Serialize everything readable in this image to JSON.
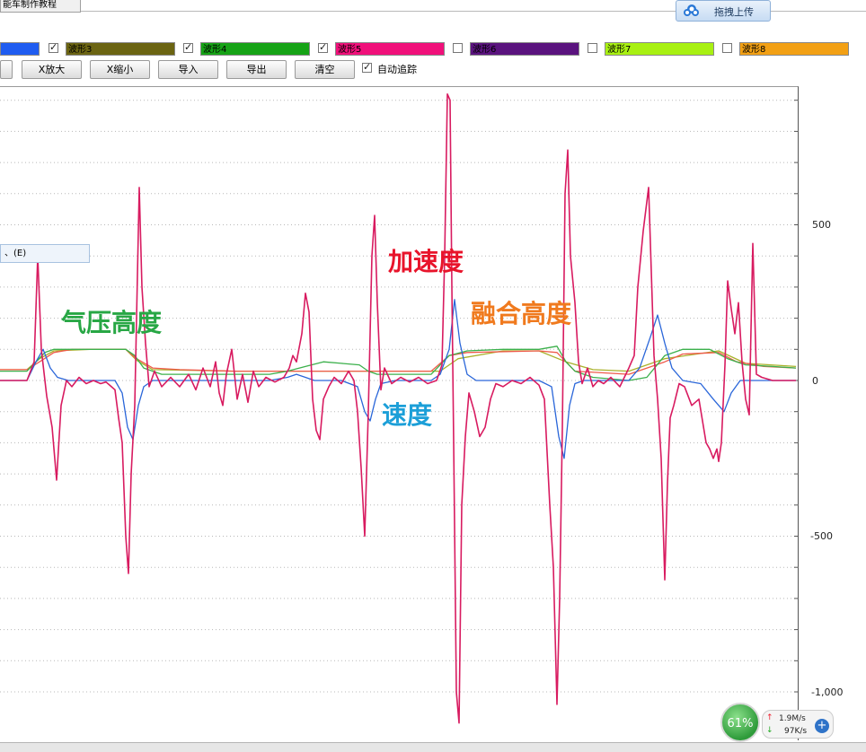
{
  "window": {
    "tab_title": "能车制作教程"
  },
  "upload_button": {
    "label": "拖拽上传",
    "icon": "cloud-icon"
  },
  "waveforms": [
    {
      "label": "",
      "checked": false,
      "color": "#1f5cf0"
    },
    {
      "label": "波形3",
      "checked": true,
      "color": "#6b6412"
    },
    {
      "label": "波形4",
      "checked": true,
      "color": "#16a316"
    },
    {
      "label": "波形5",
      "checked": true,
      "color": "#f0107a"
    },
    {
      "label": "波形6",
      "checked": false,
      "color": "#5a137e"
    },
    {
      "label": "波形7",
      "checked": false,
      "color": "#a8f012"
    },
    {
      "label": "波形8",
      "checked": false,
      "color": "#f2a014"
    }
  ],
  "toolbar": {
    "buttons": [
      "X放大",
      "X缩小",
      "导入",
      "导出",
      "清空"
    ],
    "auto_track_label": "自动追踪",
    "auto_track_checked": true
  },
  "tooltip": {
    "text": "、(E)"
  },
  "annotations": {
    "air_pressure": {
      "text": "气压高度",
      "color": "#28a745"
    },
    "acceleration": {
      "text": "加速度",
      "color": "#e8142b"
    },
    "fused_height": {
      "text": "融合高度",
      "color": "#f07a1e"
    },
    "velocity": {
      "text": "速度",
      "color": "#1c9fd8"
    }
  },
  "status": {
    "cpu_percent": "61%",
    "upload_speed": "1.9M/s",
    "download_speed": "97K/s"
  },
  "chart_data": {
    "type": "line",
    "y_ticks": [
      "500",
      "0",
      "-500",
      "-1,000"
    ],
    "ylim": [
      -1100,
      920
    ],
    "grid": "horizontal dotted",
    "series": [
      {
        "name": "加速度",
        "color": "#d81b60",
        "points": [
          [
            0,
            0
          ],
          [
            30,
            0
          ],
          [
            38,
            60
          ],
          [
            42,
            400
          ],
          [
            46,
            100
          ],
          [
            52,
            -50
          ],
          [
            58,
            -150
          ],
          [
            63,
            -320
          ],
          [
            68,
            -80
          ],
          [
            74,
            0
          ],
          [
            80,
            -20
          ],
          [
            88,
            10
          ],
          [
            96,
            -10
          ],
          [
            104,
            0
          ],
          [
            112,
            -10
          ],
          [
            118,
            -5
          ],
          [
            124,
            -20
          ],
          [
            128,
            -30
          ],
          [
            132,
            -120
          ],
          [
            136,
            -200
          ],
          [
            140,
            -500
          ],
          [
            143,
            -620
          ],
          [
            146,
            -300
          ],
          [
            150,
            -80
          ],
          [
            152,
            200
          ],
          [
            155,
            620
          ],
          [
            158,
            300
          ],
          [
            162,
            120
          ],
          [
            166,
            -20
          ],
          [
            172,
            30
          ],
          [
            180,
            -20
          ],
          [
            190,
            10
          ],
          [
            200,
            -20
          ],
          [
            210,
            20
          ],
          [
            218,
            -30
          ],
          [
            226,
            40
          ],
          [
            234,
            -20
          ],
          [
            240,
            60
          ],
          [
            244,
            -40
          ],
          [
            248,
            -80
          ],
          [
            252,
            20
          ],
          [
            258,
            100
          ],
          [
            264,
            -60
          ],
          [
            270,
            20
          ],
          [
            276,
            -70
          ],
          [
            282,
            30
          ],
          [
            288,
            -20
          ],
          [
            296,
            10
          ],
          [
            306,
            -5
          ],
          [
            316,
            10
          ],
          [
            322,
            40
          ],
          [
            326,
            80
          ],
          [
            330,
            60
          ],
          [
            336,
            150
          ],
          [
            340,
            280
          ],
          [
            344,
            220
          ],
          [
            348,
            -60
          ],
          [
            352,
            -160
          ],
          [
            356,
            -190
          ],
          [
            360,
            -60
          ],
          [
            366,
            -20
          ],
          [
            372,
            10
          ],
          [
            380,
            -10
          ],
          [
            388,
            30
          ],
          [
            394,
            0
          ],
          [
            398,
            -100
          ],
          [
            402,
            -280
          ],
          [
            406,
            -500
          ],
          [
            410,
            -100
          ],
          [
            414,
            400
          ],
          [
            417,
            530
          ],
          [
            420,
            250
          ],
          [
            424,
            -30
          ],
          [
            428,
            40
          ],
          [
            436,
            -10
          ],
          [
            446,
            10
          ],
          [
            456,
            -5
          ],
          [
            466,
            10
          ],
          [
            476,
            -10
          ],
          [
            486,
            0
          ],
          [
            492,
            50
          ],
          [
            495,
            400
          ],
          [
            498,
            920
          ],
          [
            501,
            900
          ],
          [
            503,
            300
          ],
          [
            505,
            -200
          ],
          [
            508,
            -1000
          ],
          [
            511,
            -1100
          ],
          [
            514,
            -400
          ],
          [
            518,
            -180
          ],
          [
            522,
            -40
          ],
          [
            528,
            -100
          ],
          [
            534,
            -180
          ],
          [
            540,
            -150
          ],
          [
            546,
            -60
          ],
          [
            552,
            -10
          ],
          [
            560,
            -20
          ],
          [
            570,
            0
          ],
          [
            580,
            -10
          ],
          [
            590,
            10
          ],
          [
            600,
            -15
          ],
          [
            606,
            -60
          ],
          [
            612,
            -400
          ],
          [
            616,
            -600
          ],
          [
            620,
            -1040
          ],
          [
            623,
            -700
          ],
          [
            626,
            -150
          ],
          [
            629,
            600
          ],
          [
            632,
            740
          ],
          [
            635,
            400
          ],
          [
            640,
            250
          ],
          [
            644,
            60
          ],
          [
            648,
            -10
          ],
          [
            654,
            40
          ],
          [
            660,
            -20
          ],
          [
            666,
            0
          ],
          [
            672,
            -10
          ],
          [
            680,
            10
          ],
          [
            690,
            -20
          ],
          [
            700,
            40
          ],
          [
            706,
            80
          ],
          [
            710,
            300
          ],
          [
            716,
            480
          ],
          [
            722,
            620
          ],
          [
            725,
            350
          ],
          [
            728,
            80
          ],
          [
            732,
            -60
          ],
          [
            736,
            -250
          ],
          [
            740,
            -640
          ],
          [
            743,
            -330
          ],
          [
            746,
            -120
          ],
          [
            750,
            -80
          ],
          [
            756,
            -10
          ],
          [
            762,
            -20
          ],
          [
            770,
            -80
          ],
          [
            778,
            -60
          ],
          [
            786,
            -200
          ],
          [
            790,
            -220
          ],
          [
            794,
            -250
          ],
          [
            798,
            -220
          ],
          [
            800,
            -260
          ],
          [
            803,
            -200
          ],
          [
            807,
            50
          ],
          [
            810,
            320
          ],
          [
            814,
            230
          ],
          [
            818,
            150
          ],
          [
            822,
            250
          ],
          [
            826,
            60
          ],
          [
            830,
            -60
          ],
          [
            834,
            -110
          ],
          [
            838,
            440
          ],
          [
            842,
            20
          ],
          [
            848,
            10
          ],
          [
            860,
            0
          ],
          [
            870,
            0
          ],
          [
            886,
            0
          ]
        ]
      },
      {
        "name": "速度",
        "color": "#2a66d9",
        "points": [
          [
            0,
            0
          ],
          [
            30,
            0
          ],
          [
            40,
            60
          ],
          [
            48,
            100
          ],
          [
            56,
            40
          ],
          [
            64,
            10
          ],
          [
            76,
            0
          ],
          [
            100,
            0
          ],
          [
            128,
            0
          ],
          [
            136,
            -40
          ],
          [
            142,
            -150
          ],
          [
            148,
            -190
          ],
          [
            154,
            -80
          ],
          [
            160,
            -20
          ],
          [
            170,
            0
          ],
          [
            300,
            0
          ],
          [
            320,
            10
          ],
          [
            330,
            20
          ],
          [
            340,
            10
          ],
          [
            350,
            0
          ],
          [
            380,
            0
          ],
          [
            398,
            -20
          ],
          [
            406,
            -100
          ],
          [
            412,
            -130
          ],
          [
            418,
            -60
          ],
          [
            424,
            -10
          ],
          [
            440,
            0
          ],
          [
            480,
            0
          ],
          [
            490,
            20
          ],
          [
            500,
            100
          ],
          [
            506,
            260
          ],
          [
            512,
            120
          ],
          [
            520,
            20
          ],
          [
            530,
            0
          ],
          [
            600,
            0
          ],
          [
            614,
            -20
          ],
          [
            622,
            -180
          ],
          [
            628,
            -250
          ],
          [
            634,
            -80
          ],
          [
            640,
            -10
          ],
          [
            650,
            0
          ],
          [
            700,
            0
          ],
          [
            712,
            40
          ],
          [
            724,
            140
          ],
          [
            732,
            210
          ],
          [
            740,
            120
          ],
          [
            748,
            40
          ],
          [
            760,
            0
          ],
          [
            780,
            -10
          ],
          [
            794,
            -60
          ],
          [
            806,
            -100
          ],
          [
            814,
            -40
          ],
          [
            824,
            0
          ],
          [
            886,
            0
          ]
        ]
      },
      {
        "name": "气压高度",
        "color": "#3bb04b",
        "points": [
          [
            0,
            30
          ],
          [
            30,
            30
          ],
          [
            40,
            60
          ],
          [
            50,
            90
          ],
          [
            60,
            100
          ],
          [
            80,
            100
          ],
          [
            110,
            100
          ],
          [
            140,
            100
          ],
          [
            150,
            80
          ],
          [
            160,
            40
          ],
          [
            180,
            20
          ],
          [
            260,
            20
          ],
          [
            300,
            20
          ],
          [
            320,
            30
          ],
          [
            340,
            45
          ],
          [
            360,
            60
          ],
          [
            380,
            55
          ],
          [
            400,
            50
          ],
          [
            410,
            30
          ],
          [
            420,
            20
          ],
          [
            480,
            20
          ],
          [
            500,
            80
          ],
          [
            520,
            95
          ],
          [
            560,
            100
          ],
          [
            600,
            100
          ],
          [
            620,
            110
          ],
          [
            630,
            60
          ],
          [
            640,
            30
          ],
          [
            660,
            10
          ],
          [
            700,
            0
          ],
          [
            720,
            10
          ],
          [
            740,
            80
          ],
          [
            760,
            100
          ],
          [
            790,
            100
          ],
          [
            810,
            70
          ],
          [
            830,
            50
          ],
          [
            860,
            45
          ],
          [
            886,
            40
          ]
        ]
      },
      {
        "name": "融合高度",
        "color": "#ef5a4a",
        "points": [
          [
            0,
            35
          ],
          [
            30,
            35
          ],
          [
            44,
            60
          ],
          [
            60,
            90
          ],
          [
            80,
            100
          ],
          [
            140,
            100
          ],
          [
            152,
            70
          ],
          [
            170,
            40
          ],
          [
            200,
            35
          ],
          [
            260,
            30
          ],
          [
            300,
            30
          ],
          [
            340,
            30
          ],
          [
            380,
            30
          ],
          [
            420,
            30
          ],
          [
            480,
            30
          ],
          [
            500,
            80
          ],
          [
            520,
            90
          ],
          [
            600,
            95
          ],
          [
            620,
            90
          ],
          [
            630,
            60
          ],
          [
            640,
            30
          ],
          [
            700,
            20
          ],
          [
            740,
            60
          ],
          [
            760,
            85
          ],
          [
            800,
            90
          ],
          [
            820,
            60
          ],
          [
            850,
            45
          ],
          [
            886,
            40
          ]
        ]
      },
      {
        "name": "",
        "color": "#a9b12a",
        "points": [
          [
            0,
            35
          ],
          [
            30,
            35
          ],
          [
            44,
            70
          ],
          [
            60,
            95
          ],
          [
            100,
            100
          ],
          [
            140,
            100
          ],
          [
            152,
            65
          ],
          [
            170,
            35
          ],
          [
            260,
            30
          ],
          [
            420,
            30
          ],
          [
            490,
            30
          ],
          [
            510,
            70
          ],
          [
            560,
            95
          ],
          [
            600,
            95
          ],
          [
            630,
            60
          ],
          [
            660,
            35
          ],
          [
            700,
            30
          ],
          [
            740,
            70
          ],
          [
            800,
            95
          ],
          [
            830,
            55
          ],
          [
            886,
            45
          ]
        ]
      }
    ]
  }
}
